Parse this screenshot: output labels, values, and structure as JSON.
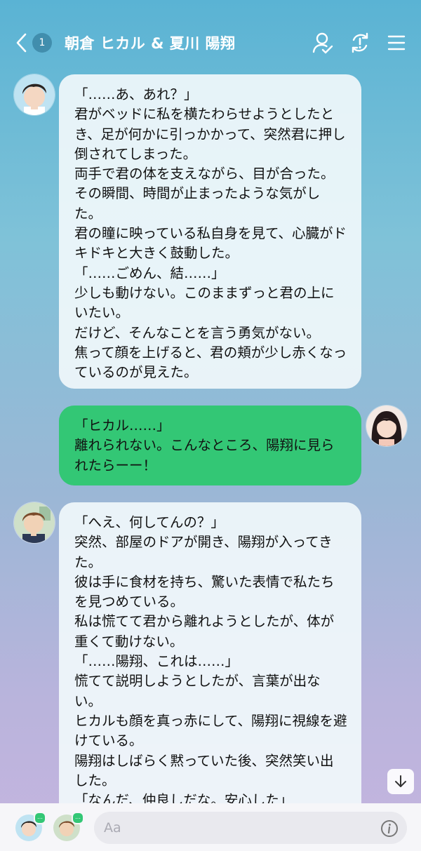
{
  "header": {
    "back_icon": "chevron-left-icon",
    "unread_count": "1",
    "title": "朝倉 ヒカル & 夏川 陽翔",
    "icons": [
      "person-check-icon",
      "sync-alert-icon",
      "menu-icon"
    ]
  },
  "messages": [
    {
      "sender": "ヒカル",
      "direction": "incoming",
      "text": "「……あ、あれ？」\n君がベッドに私を横たわらせようとしたとき、足が何かに引っかかって、突然君に押し倒されてしまった。\n両手で君の体を支えながら、目が合った。\nその瞬間、時間が止まったような気がした。\n君の瞳に映っている私自身を見て、心臓がドキドキと大きく鼓動した。\n「……ごめん、結……」\n少しも動けない。このままずっと君の上にいたい。\nだけど、そんなことを言う勇気がない。\n焦って顔を上げると、君の頬が少し赤くなっているのが見えた。"
    },
    {
      "sender": "me",
      "direction": "outgoing",
      "text": "「ヒカル……」\n離れられない。こんなところ、陽翔に見られたらーー！"
    },
    {
      "sender": "陽翔",
      "direction": "incoming",
      "text": "「へえ、何してんの？」\n突然、部屋のドアが開き、陽翔が入ってきた。\n彼は手に食材を持ち、驚いた表情で私たちを見つめている。\n私は慌てて君から離れようとしたが、体が重くて動けない。\n「……陽翔、これは……」\n慌てて説明しようとしたが、言葉が出ない。\nヒカルも顔を真っ赤にして、陽翔に視線を避けている。\n陽翔はしばらく黙っていた後、突然笑い出した。\n「なんだ、仲良しだな。安心した」"
    }
  ],
  "bottom_bar": {
    "input_placeholder": "Aa",
    "typing_indicator": "…",
    "info_icon": "info-icon",
    "scroll_icon": "arrow-down-icon"
  },
  "colors": {
    "outgoing_bubble": "#33c775",
    "incoming_bubble": "#f0f8fb",
    "header_gradient_top": "#5ab3d4",
    "background_bottom": "#c5b5df"
  }
}
